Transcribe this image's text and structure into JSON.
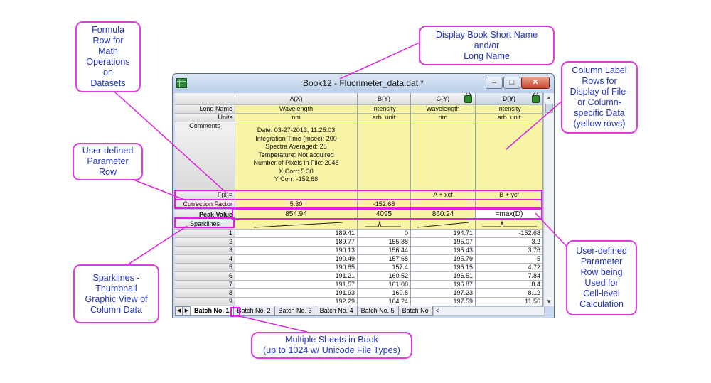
{
  "window": {
    "title": "Book12 - Fluorimeter_data.dat *",
    "buttons": {
      "minimize": "–",
      "maximize": "□",
      "close": "✕"
    }
  },
  "columns": [
    {
      "name": "A(X)",
      "long_name": "Wavelength",
      "units": "nm",
      "fx": "",
      "correction": "5.30",
      "peak": "854.94",
      "locked": false
    },
    {
      "name": "B(Y)",
      "long_name": "Intensity",
      "units": "arb. unit",
      "fx": "",
      "correction": "-152.68",
      "peak": "4095",
      "locked": false
    },
    {
      "name": "C(Y)",
      "long_name": "Wavelength",
      "units": "nm",
      "fx": "A + xcf",
      "correction": "",
      "peak": "860.24",
      "locked": true
    },
    {
      "name": "D(Y)",
      "long_name": "Intensity",
      "units": "arb. unit",
      "fx": "B + ycf",
      "correction": "",
      "peak": "=max(D)",
      "locked": true
    }
  ],
  "row_labels": {
    "long_name": "Long Name",
    "units": "Units",
    "comments": "Comments",
    "fx": "F(x)=",
    "correction": "Correction Factor",
    "peak": "Peak Value",
    "sparklines": "Sparklines"
  },
  "comments_lines": [
    "Date: 03-27-2013, 11:25:03",
    "Integration Time (msec): 200",
    "Spectra Averaged: 25",
    "Temperature: Not acquired",
    "Number of Pixels in File: 2048",
    "X Corr: 5.30",
    "Y Corr: -152.68"
  ],
  "data_rows": [
    {
      "n": "1",
      "a": "189.41",
      "b": "0",
      "c": "194.71",
      "d": "-152.68"
    },
    {
      "n": "2",
      "a": "189.77",
      "b": "155.88",
      "c": "195.07",
      "d": "3.2"
    },
    {
      "n": "3",
      "a": "190.13",
      "b": "156.44",
      "c": "195.43",
      "d": "3.76"
    },
    {
      "n": "4",
      "a": "190.49",
      "b": "157.68",
      "c": "195.79",
      "d": "5"
    },
    {
      "n": "5",
      "a": "190.85",
      "b": "157.4",
      "c": "196.15",
      "d": "4.72"
    },
    {
      "n": "6",
      "a": "191.21",
      "b": "160.52",
      "c": "196.51",
      "d": "7.84"
    },
    {
      "n": "7",
      "a": "191.57",
      "b": "161.08",
      "c": "196.87",
      "d": "8.4"
    },
    {
      "n": "8",
      "a": "191.93",
      "b": "160.8",
      "c": "197.23",
      "d": "8.12"
    },
    {
      "n": "9",
      "a": "192.29",
      "b": "164.24",
      "c": "197.59",
      "d": "11.56"
    }
  ],
  "sheet_tabs": [
    "Batch No. 1",
    "Batch No. 2",
    "Batch No. 3",
    "Batch No. 4",
    "Batch No. 5",
    "Batch No"
  ],
  "nav": {
    "first": "◀",
    "last": "▶",
    "scroll_left": "<"
  },
  "callouts": {
    "formula_row": "Formula\nRow for\nMath\nOperations\non\nDatasets",
    "book_name": "Display Book Short Name\nand/or\nLong Name",
    "label_rows": "Column Label\nRows for\nDisplay of File-\nor Column-\nspecific Data\n(yellow rows)",
    "param_row": "User-defined\nParameter\nRow",
    "param_calc": "User-defined\nParameter\nRow being\nUsed for\nCell-level\nCalculation",
    "sparklines": "Sparklines -\nThumbnail\nGraphic View of\nColumn Data",
    "sheets": "Multiple Sheets in Book\n(up to 1024 w/ Unicode File Types)"
  },
  "colors": {
    "highlight": "#e020e0",
    "callout_text": "#2233bb",
    "label_row_bg": "#f7f5a5"
  }
}
